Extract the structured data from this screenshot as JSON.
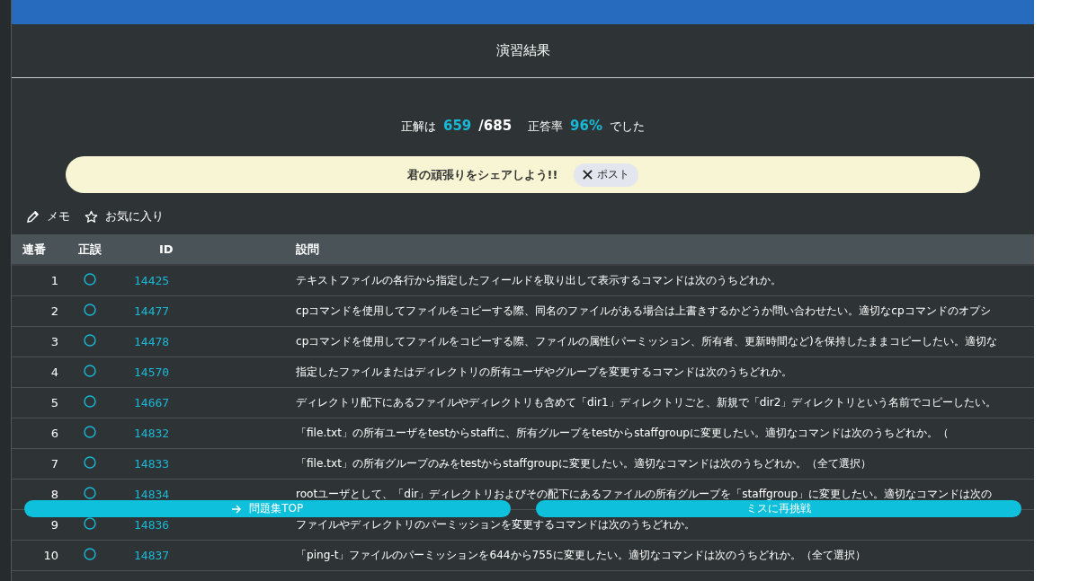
{
  "title": "演習結果",
  "score": {
    "label": "正解は",
    "correct": "659",
    "total": "/685",
    "rate_label": "正答率",
    "rate": "96%",
    "suffix": "でした"
  },
  "share": {
    "text": "君の頑張りをシェアしよう!!",
    "button": "ポスト"
  },
  "tools": [
    {
      "kind": "memo",
      "label": "メモ"
    },
    {
      "kind": "favorite",
      "label": "お気に入り"
    }
  ],
  "table": {
    "columns": [
      "連番",
      "正誤",
      "ID",
      "設問"
    ],
    "rows": [
      {
        "no": "1",
        "correct": true,
        "id": "14425",
        "question": "テキストファイルの各行から指定したフィールドを取り出して表示するコマンドは次のうちどれか。"
      },
      {
        "no": "2",
        "correct": true,
        "id": "14477",
        "question": "cpコマンドを使用してファイルをコピーする際、同名のファイルがある場合は上書きするかどうか問い合わせたい。適切なcpコマンドのオプシ"
      },
      {
        "no": "3",
        "correct": true,
        "id": "14478",
        "question": "cpコマンドを使用してファイルをコピーする際、ファイルの属性(パーミッション、所有者、更新時間など)を保持したままコピーしたい。適切な"
      },
      {
        "no": "4",
        "correct": true,
        "id": "14570",
        "question": "指定したファイルまたはディレクトリの所有ユーザやグループを変更するコマンドは次のうちどれか。"
      },
      {
        "no": "5",
        "correct": true,
        "id": "14667",
        "question": "ディレクトリ配下にあるファイルやディレクトリも含めて「dir1」ディレクトリごと、新規で「dir2」ディレクトリという名前でコピーしたい。"
      },
      {
        "no": "6",
        "correct": true,
        "id": "14832",
        "question": "「file.txt」の所有ユーザをtestからstaffに、所有グループをtestからstaffgroupに変更したい。適切なコマンドは次のうちどれか。（"
      },
      {
        "no": "7",
        "correct": true,
        "id": "14833",
        "question": "「file.txt」の所有グループのみをtestからstaffgroupに変更したい。適切なコマンドは次のうちどれか。（全て選択）"
      },
      {
        "no": "8",
        "correct": true,
        "id": "14834",
        "question": "rootユーザとして、「dir」ディレクトリおよびその配下にあるファイルの所有グループを「staffgroup」に変更したい。適切なコマンドは次の"
      },
      {
        "no": "9",
        "correct": true,
        "id": "14836",
        "question": "ファイルやディレクトリのパーミッションを変更するコマンドは次のうちどれか。"
      },
      {
        "no": "10",
        "correct": true,
        "id": "14837",
        "question": "「ping-t」ファイルのパーミッションを644から755に変更したい。適切なコマンドは次のうちどれか。（全て選択）"
      }
    ]
  },
  "actions": [
    {
      "kind": "top",
      "label": "問題集TOP"
    },
    {
      "kind": "retry",
      "label": "ミスに再挑戦"
    }
  ]
}
